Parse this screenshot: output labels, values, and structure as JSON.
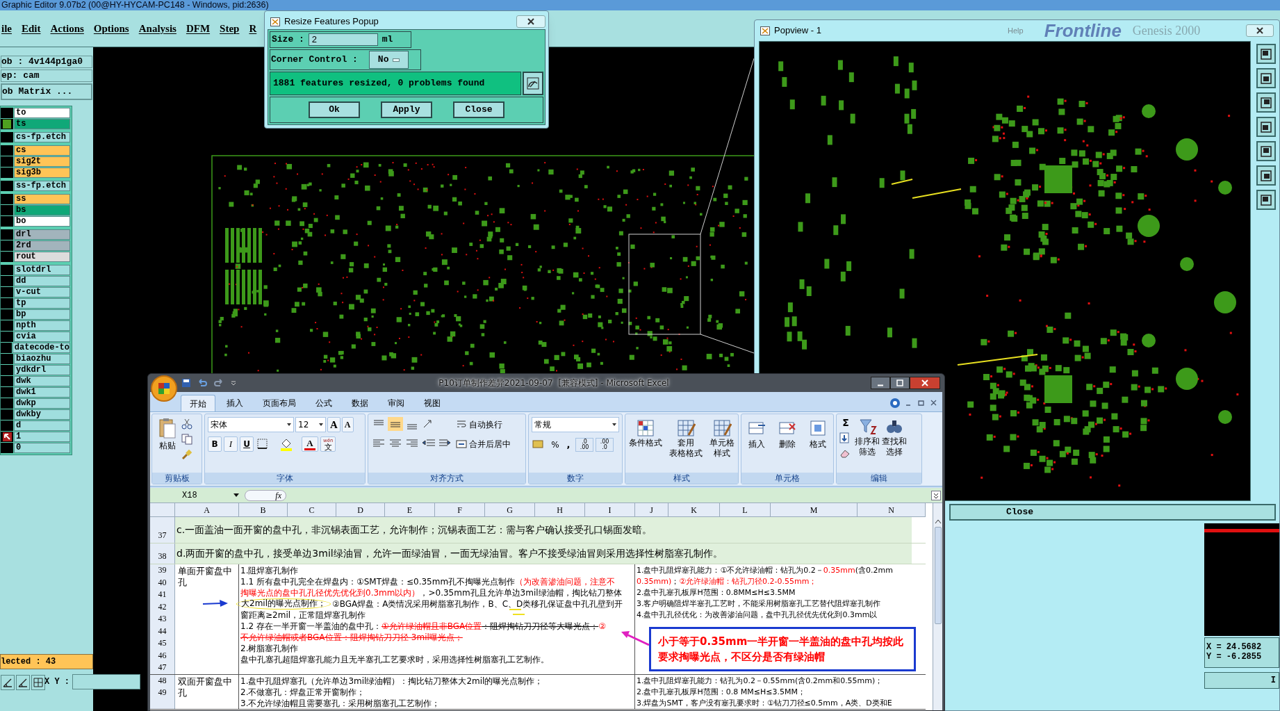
{
  "app": {
    "title": "Graphic Editor 9.07b2 (00@HY-HYCAM-PC148 - Windows, pid:2636)",
    "menu": [
      "ile",
      "Edit",
      "Actions",
      "Options",
      "Analysis",
      "DFM",
      "Step",
      "R"
    ]
  },
  "job_panel": {
    "job": "ob : 4v144p1ga0",
    "step": "ep: cam",
    "matrix_button": "ob Matrix ...",
    "layer_groups": [
      [
        {
          "name": "to",
          "color": "#ffffff",
          "displayed": false,
          "work": false
        },
        {
          "name": "ts",
          "color": "#10a878",
          "displayed": true,
          "work": false
        }
      ],
      [
        {
          "name": "cs-fp.etch",
          "color": "#a0dede",
          "displayed": false,
          "work": false
        }
      ],
      [
        {
          "name": "cs",
          "color": "#ffc457",
          "displayed": false,
          "work": false
        },
        {
          "name": "sig2t",
          "color": "#ffc457",
          "displayed": false,
          "work": false
        },
        {
          "name": "sig3b",
          "color": "#ffc457",
          "displayed": false,
          "work": false
        }
      ],
      [
        {
          "name": "ss-fp.etch",
          "color": "#a0dede",
          "displayed": false,
          "work": false
        }
      ],
      [
        {
          "name": "ss",
          "color": "#ffc457",
          "displayed": false,
          "work": false
        },
        {
          "name": "bs",
          "color": "#10a878",
          "displayed": false,
          "work": false
        },
        {
          "name": "bo",
          "color": "#ffffff",
          "displayed": false,
          "work": false
        }
      ],
      [
        {
          "name": "drl",
          "color": "#a2b4bc",
          "displayed": false,
          "work": false
        },
        {
          "name": "2rd",
          "color": "#a2b4bc",
          "displayed": false,
          "work": false
        },
        {
          "name": "rout",
          "color": "#dcdcdc",
          "displayed": false,
          "work": false
        }
      ],
      [
        {
          "name": "slotdrl",
          "color": "#a0dede",
          "displayed": false,
          "work": false
        },
        {
          "name": "dd",
          "color": "#a0dede",
          "displayed": false,
          "work": false
        },
        {
          "name": "v-cut",
          "color": "#a0dede",
          "displayed": false,
          "work": false
        },
        {
          "name": "tp",
          "color": "#a0dede",
          "displayed": false,
          "work": false
        },
        {
          "name": "bp",
          "color": "#a0dede",
          "displayed": false,
          "work": false
        },
        {
          "name": "npth",
          "color": "#a0dede",
          "displayed": false,
          "work": false
        },
        {
          "name": "cvia",
          "color": "#a0dede",
          "displayed": false,
          "work": false
        },
        {
          "name": "datecode-to",
          "color": "#a0dede",
          "displayed": false,
          "work": false
        },
        {
          "name": "biaozhu",
          "color": "#a0dede",
          "displayed": false,
          "work": false
        },
        {
          "name": "ydkdrl",
          "color": "#a0dede",
          "displayed": false,
          "work": false
        },
        {
          "name": "dwk",
          "color": "#a0dede",
          "displayed": false,
          "work": false
        },
        {
          "name": "dwk1",
          "color": "#a0dede",
          "displayed": false,
          "work": false
        },
        {
          "name": "dwkp",
          "color": "#a0dede",
          "displayed": false,
          "work": false
        },
        {
          "name": "dwkby",
          "color": "#a0dede",
          "displayed": false,
          "work": false
        },
        {
          "name": "d",
          "color": "#a0dede",
          "displayed": false,
          "work": false
        },
        {
          "name": "1",
          "color": "#a0dede",
          "displayed": false,
          "work": true
        },
        {
          "name": "0",
          "color": "#a0dede",
          "displayed": false,
          "work": false
        }
      ]
    ],
    "selected_count": "lected : 43",
    "xy_label": "X Y :"
  },
  "resize_popup": {
    "title": "Resize Features Popup",
    "size_label": "Size :",
    "size_value": "2",
    "size_unit": "ml",
    "corner_label": "Corner Control :",
    "corner_value": "No",
    "status": "1881 features resized, 0 problems found",
    "buttons": [
      "Ok",
      "Apply",
      "Close"
    ]
  },
  "popview": {
    "title": "Popview - 1",
    "background_texts": [
      "Help",
      "Frontline",
      "Genesis 2000"
    ],
    "close_button": "Close",
    "coordinates": [
      "X = 24.5682",
      "Y = -6.2855"
    ],
    "corner_text": "I"
  },
  "excel": {
    "title": "P10订单制作差异2021-09-07  [兼容模式] - Microsoft Excel",
    "tabs": [
      {
        "label": "开始",
        "selected": true
      },
      {
        "label": "插入",
        "selected": false
      },
      {
        "label": "页面布局",
        "selected": false
      },
      {
        "label": "公式",
        "selected": false
      },
      {
        "label": "数据",
        "selected": false
      },
      {
        "label": "审阅",
        "selected": false
      },
      {
        "label": "视图",
        "selected": false
      }
    ],
    "ribbon": {
      "paste": "粘贴",
      "font_name": "宋体",
      "font_size": "12",
      "grow_font": "A",
      "shrink_font": "A",
      "bold": "B",
      "italic": "I",
      "underline": "U",
      "font_color": "A",
      "phonetic": [
        "wén",
        "文"
      ],
      "wrap_text": "自动换行",
      "merge_center": "合并后居中",
      "number_format": "常规",
      "percent": "%",
      "comma": ",",
      "decimals": [
        [
          ".0",
          ".00"
        ],
        [
          ".00",
          ".0"
        ]
      ],
      "styles": [
        [
          "条件格式"
        ],
        [
          "套用",
          "表格格式"
        ],
        [
          "单元格",
          "样式"
        ]
      ],
      "cells": [
        "插入",
        "删除",
        "格式"
      ],
      "sum": "Σ",
      "editing": [
        [
          "排序和",
          "筛选"
        ],
        [
          "查找和",
          "选择"
        ]
      ],
      "groups": [
        "剪贴板",
        "字体",
        "对齐方式",
        "数字",
        "样式",
        "单元格",
        "编辑"
      ]
    },
    "name_box": "X18",
    "fx": "fx",
    "columns": [
      "A",
      "B",
      "C",
      "D",
      "E",
      "F",
      "G",
      "H",
      "I",
      "J",
      "K",
      "L",
      "M",
      "N"
    ],
    "rows": [
      {
        "number": "37",
        "text": "c.一面盖油一面开窗的盘中孔，非沉锡表面工艺，允许制作；沉锡表面工艺：需与客户确认接受孔口锡面发暗。"
      },
      {
        "number": "38",
        "text": "d.两面开窗的盘中孔，接受单边3mil绿油冒，允许一面绿油冒，一面无绿油冒。客户不接受绿油冒则采用选择性树脂塞孔制作。"
      }
    ],
    "blocks": [
      {
        "row_numbers": [
          "39",
          "40",
          "41",
          "42",
          "43",
          "44",
          "45",
          "46",
          "47"
        ],
        "category": "单面开窗盘中孔",
        "process": [
          [
            {
              "text": "1.阻焊塞孔制作",
              "kind": "plain"
            }
          ],
          [
            {
              "text": "1.1 所有盘中孔完全在焊盘内：①SMT焊盘：≤0.35mm孔不掏曝光点制作",
              "kind": "plain"
            },
            {
              "text": "（为改善渗油问题，注意不",
              "kind": "red"
            }
          ],
          [
            {
              "text": "掏曝光点的盘中孔孔径优先优化到0.3mm以内）",
              "kind": "red"
            },
            {
              "text": "，>0.35mm孔且允许单边3mil绿油帽，掏比钻刀整体",
              "kind": "plain"
            }
          ],
          [
            {
              "text": "大2mil的曝光点制作；",
              "kind": "circled"
            },
            {
              "text": "②BGA焊盘：A类情况采用树脂塞孔制作，B、C、D类移孔保证盘中孔孔壁到开",
              "kind": "plain"
            }
          ],
          [
            {
              "text": "窗距离≥2mil，正常阻焊塞孔制作",
              "kind": "plain"
            }
          ],
          [
            {
              "text": "1.2 存在一半开窗一半盖油的盘中孔：",
              "kind": "plain"
            },
            {
              "text": "①允许绿油帽且非BGA位置",
              "kind": "red-strike"
            },
            {
              "text": "：阻焊掏钻刀刀径等大曝光点；",
              "kind": "strike"
            },
            {
              "text": "②",
              "kind": "red"
            }
          ],
          [
            {
              "text": "不允许绿油帽或者BGA位置：阻焊掏钻刀刀径-3mil曝光点；",
              "kind": "red-strike"
            }
          ],
          [
            {
              "text": "2.树脂塞孔制作",
              "kind": "plain"
            }
          ],
          [
            {
              "text": "盘中孔塞孔超阻焊塞孔能力且无半塞孔工艺要求时，采用选择性树脂塞孔工艺制作。",
              "kind": "plain"
            }
          ]
        ],
        "capability": [
          [
            {
              "text": "1.盘中孔阻焊塞孔能力：①不允许绿油帽：钻孔为0.2－",
              "kind": "plain"
            },
            {
              "text": "0.35mm",
              "kind": "red"
            },
            {
              "text": "(含0.2mm",
              "kind": "plain"
            }
          ],
          [
            {
              "text": "0.35mm)",
              "kind": "red"
            },
            {
              "text": "；",
              "kind": "plain"
            },
            {
              "text": "②允许绿油帽：钻孔刀径0.2-0.55mm；",
              "kind": "red"
            }
          ],
          [
            {
              "text": "2.盘中孔塞孔板厚H范围：0.8MM≤H≤3.5MM",
              "kind": "plain"
            }
          ],
          [
            {
              "text": "3.客户明确阻焊半塞孔工艺时，不能采用树脂塞孔工艺替代阻焊塞孔制作",
              "kind": "plain"
            }
          ],
          [
            {
              "text": "4.盘中孔孔径优化：为改善渗油问题，盘中孔孔径优先优化到0.3mm以",
              "kind": "plain"
            }
          ]
        ]
      },
      {
        "row_numbers": [
          "48",
          "49"
        ],
        "category": "双面开窗盘中孔",
        "process": [
          [
            {
              "text": "1.盘中孔阻焊塞孔（允许单边3mil绿油帽）：掏比钻刀整体大2mil的曝光点制作；",
              "kind": "plain"
            }
          ],
          [
            {
              "text": "2.不做塞孔：焊盘正常开窗制作；",
              "kind": "plain"
            }
          ],
          [
            {
              "text": "3.不允许绿油帽且需要塞孔：采用树脂塞孔工艺制作；",
              "kind": "plain"
            }
          ]
        ],
        "capability": [
          [
            {
              "text": "1.盘中孔阻焊塞孔能力：钻孔为0.2－0.55mm(含0.2mm和0.55mm)；",
              "kind": "plain"
            }
          ],
          [
            {
              "text": "2.盘中孔塞孔板厚H范围：0.8 MM≤H≤3.5MM；",
              "kind": "plain"
            }
          ],
          [
            {
              "text": "3.焊盘为SMT，客户没有塞孔要求时：①钻刀刀径≤0.5mm，A类、D类和E",
              "kind": "plain"
            }
          ]
        ]
      }
    ],
    "callout": "小于等于0.35mm一半开窗一半盖油的盘中孔均按此要求掏曝光点，不区分是否有绿油帽"
  }
}
